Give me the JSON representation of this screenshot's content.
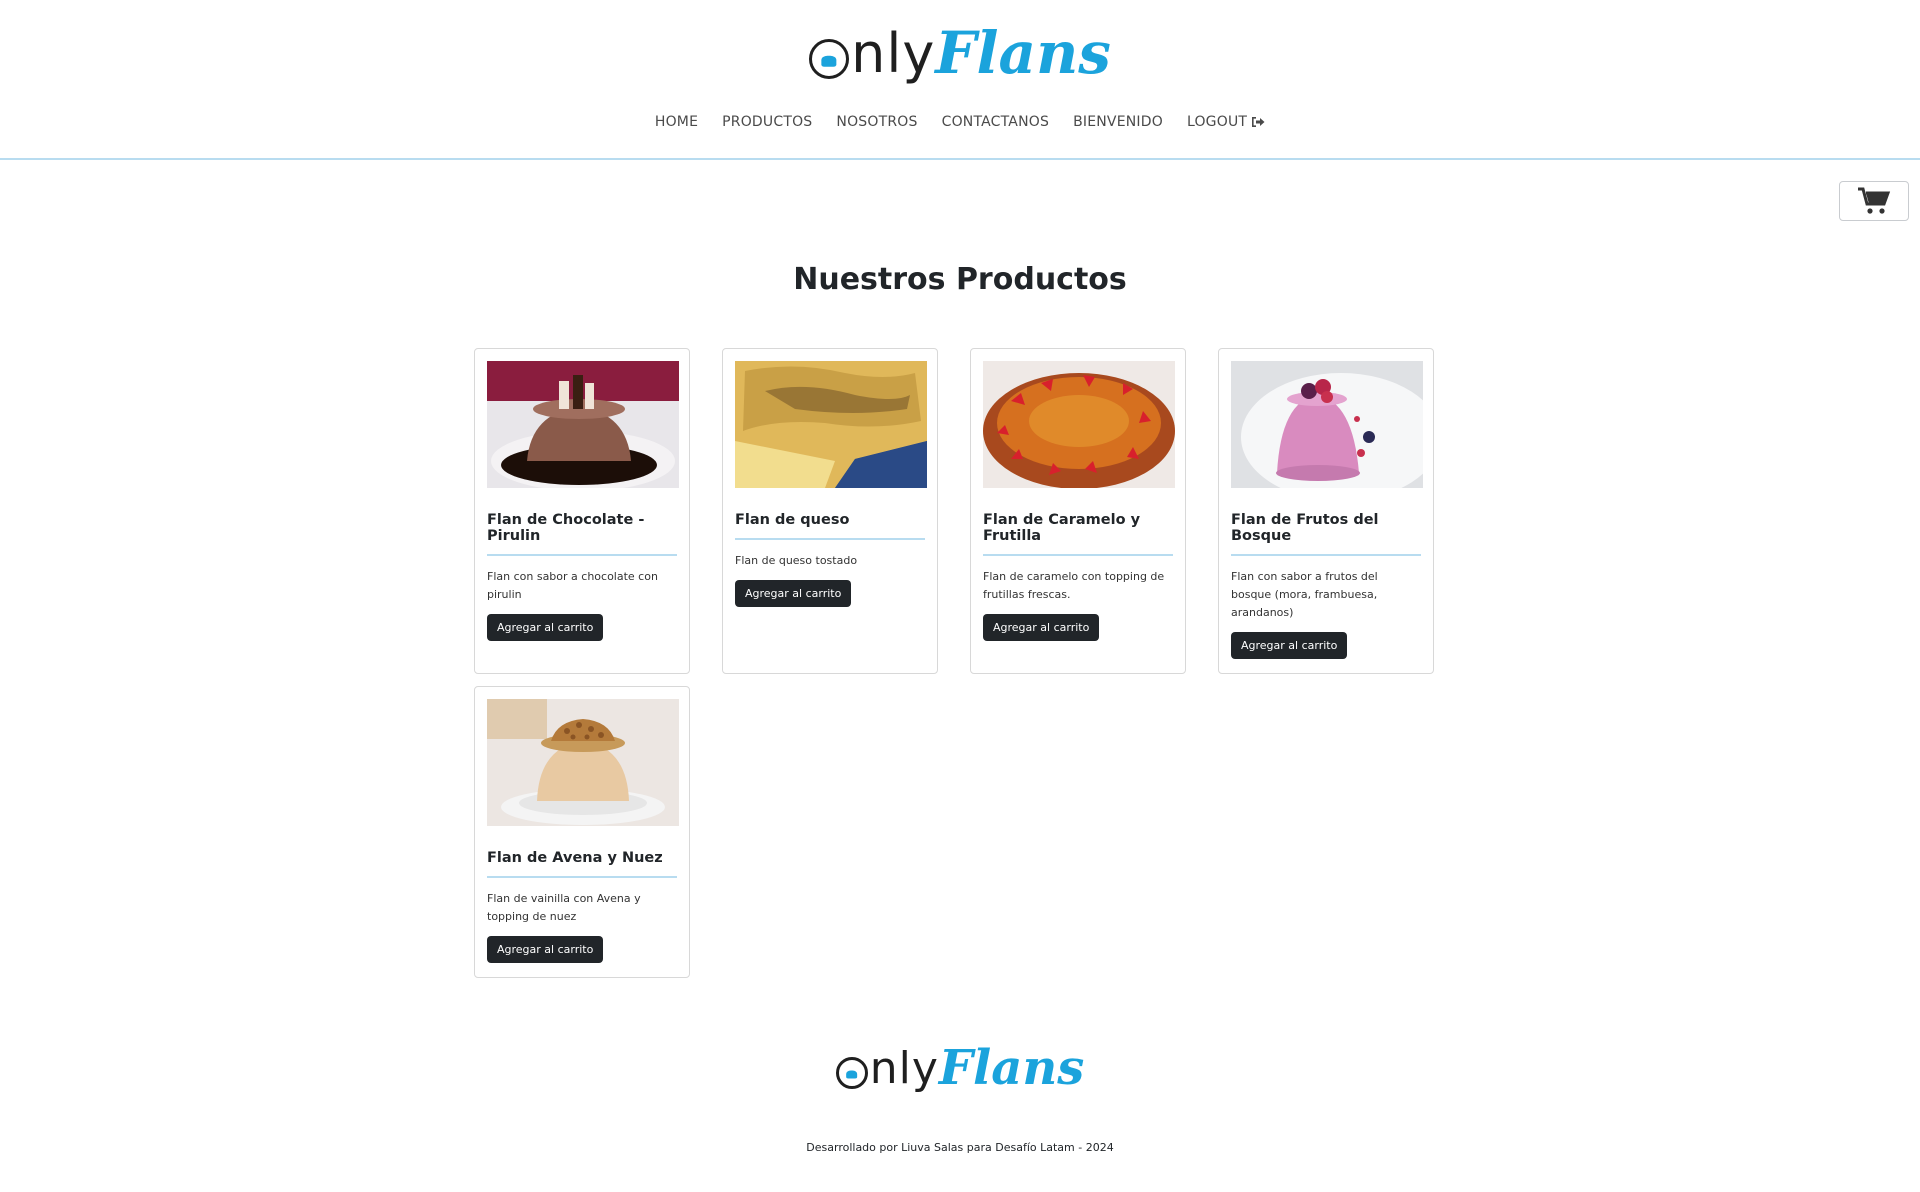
{
  "brand": {
    "only": "nly",
    "fans": "Flans",
    "accent": "#1ba3dc"
  },
  "nav": {
    "items": [
      {
        "label": "HOME"
      },
      {
        "label": "PRODUCTOS"
      },
      {
        "label": "NOSOTROS"
      },
      {
        "label": "CONTACTANOS"
      },
      {
        "label": "BIENVENIDO"
      },
      {
        "label": "LOGOUT",
        "icon": "sign-out-icon"
      }
    ]
  },
  "cart": {
    "icon": "shopping-cart-icon"
  },
  "main": {
    "title": "Nuestros Productos"
  },
  "products": [
    {
      "name": "Flan de Chocolate - Pirulin",
      "description": "Flan con sabor a chocolate con pirulin",
      "button": "Agregar al carrito"
    },
    {
      "name": "Flan de queso",
      "description": "Flan de queso tostado",
      "button": "Agregar al carrito"
    },
    {
      "name": "Flan de Caramelo y Frutilla",
      "description": "Flan de caramelo con topping de frutillas frescas.",
      "button": "Agregar al carrito"
    },
    {
      "name": "Flan de Frutos del Bosque",
      "description": "Flan con sabor a frutos del bosque (mora, frambuesa, arandanos)",
      "button": "Agregar al carrito"
    },
    {
      "name": "Flan de Avena y Nuez",
      "description": "Flan de vainilla con Avena y topping de nuez",
      "button": "Agregar al carrito"
    }
  ],
  "footer": {
    "credit": "Desarrollado por Liuva Salas para Desafío Latam - 2024"
  }
}
